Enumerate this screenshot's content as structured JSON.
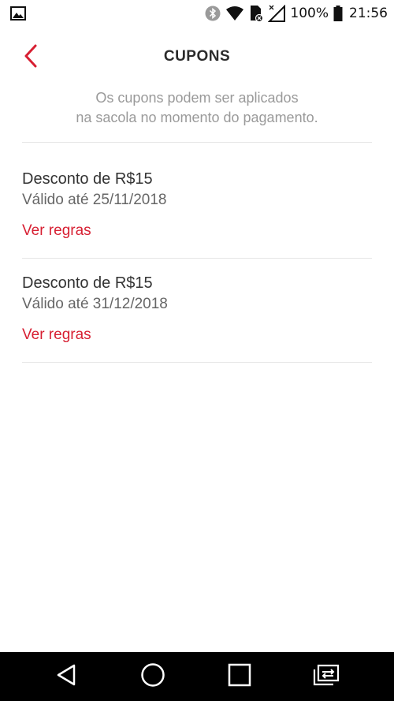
{
  "status_bar": {
    "battery_percent": "100%",
    "time": "21:56",
    "icons": [
      "gallery-icon",
      "bluetooth-icon",
      "wifi-icon",
      "sim-icon",
      "signal-icon",
      "battery-icon"
    ]
  },
  "header": {
    "title": "CUPONS",
    "back_icon": "chevron-left-icon"
  },
  "subtitle": {
    "line1": "Os cupons podem ser aplicados",
    "line2": "na sacola no momento do pagamento."
  },
  "coupons": [
    {
      "title": "Desconto de R$15",
      "valid": "Válido até 25/11/2018",
      "rules_label": "Ver regras"
    },
    {
      "title": "Desconto de R$15",
      "valid": "Válido até 31/12/2018",
      "rules_label": "Ver regras"
    }
  ],
  "nav_bar": {
    "icons": [
      "back-triangle-icon",
      "home-circle-icon",
      "recents-square-icon",
      "switch-app-icon"
    ]
  },
  "colors": {
    "accent": "#d71f32",
    "title_text": "#2b2b2b",
    "secondary_text": "#9a9a9a",
    "nav_background": "#000000"
  }
}
